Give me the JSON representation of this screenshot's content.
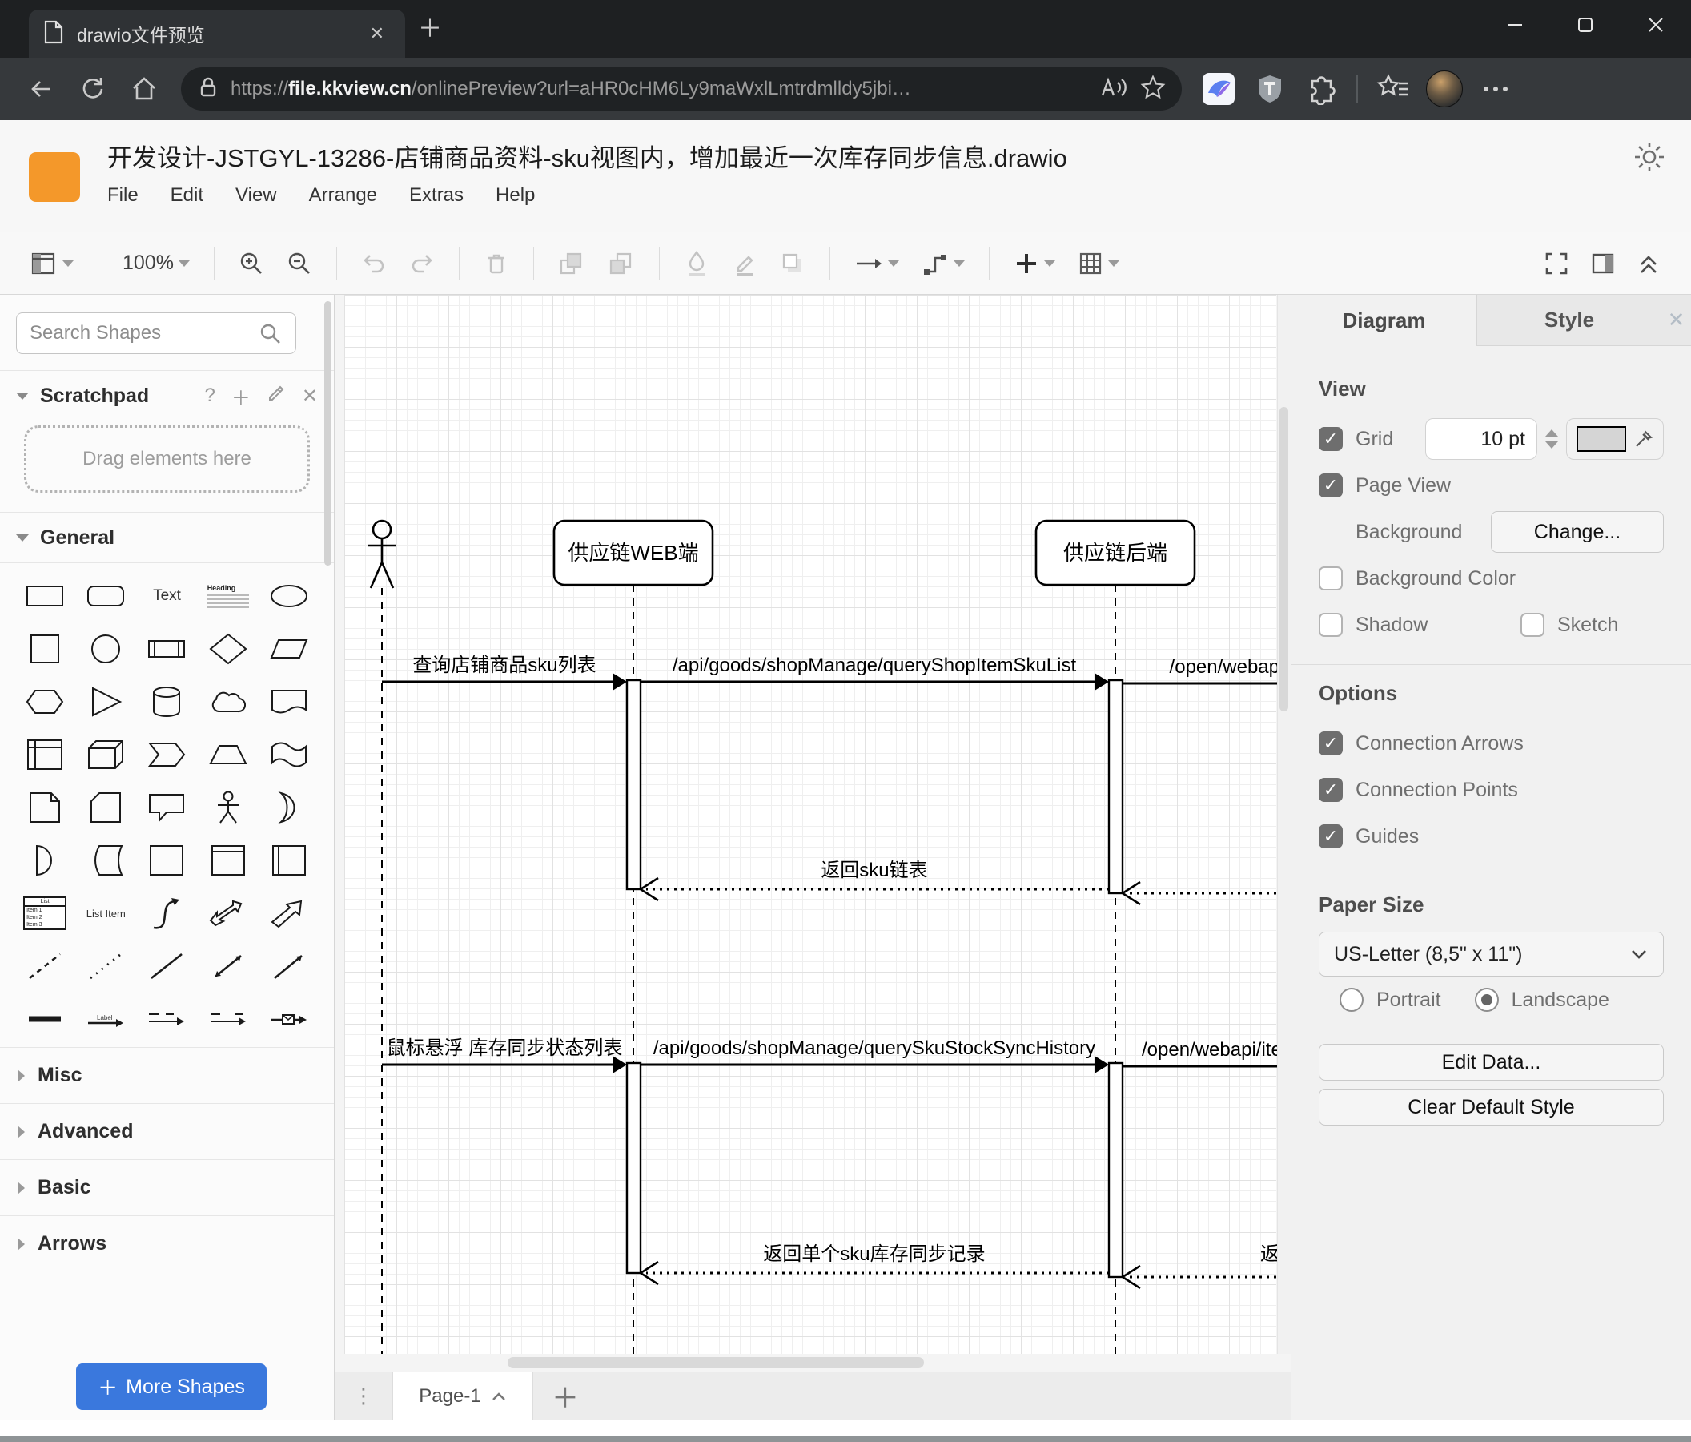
{
  "browser": {
    "tab_title": "drawio文件预览",
    "url": {
      "scheme": "https://",
      "host": "file.kkview.cn",
      "rest": "/onlinePreview?url=aHR0cHM6Ly9maWxlLmtrdmlldy5jbi…"
    }
  },
  "icons": {
    "close": "✕",
    "add": "＋",
    "question": "?",
    "dots_vertical": "⋮"
  },
  "app": {
    "title": "开发设计-JSTGYL-13286-店铺商品资料-sku视图内，增加最近一次库存同步信息.drawio",
    "menu": [
      "File",
      "Edit",
      "View",
      "Arrange",
      "Extras",
      "Help"
    ],
    "zoom": "100%"
  },
  "sidebar": {
    "search_placeholder": "Search Shapes",
    "scratchpad_title": "Scratchpad",
    "scratchpad_hint": "Drag elements here",
    "sections": {
      "general": "General",
      "misc": "Misc",
      "advanced": "Advanced",
      "basic": "Basic",
      "arrows": "Arrows"
    },
    "shapes": {
      "text": "Text",
      "heading": "Heading",
      "list": "List",
      "item1": "Item 1",
      "item2": "Item 2",
      "item3": "Item 3",
      "list_item": "List Item",
      "label": "Label"
    },
    "more_shapes": "More Shapes"
  },
  "diagram": {
    "lifelines": {
      "web": "供应链WEB端",
      "backend": "供应链后端"
    },
    "messages": {
      "m1": "查询店铺商品sku列表",
      "m2": "/api/goods/shopManage/queryShopItemSkuList",
      "m3": "/open/webapi/",
      "r1": "返回sku链表",
      "m4": "鼠标悬浮 库存同步状态列表",
      "m5": "/api/goods/shopManage/querySkuStockSyncHistory",
      "m6": "/open/webapi/iten",
      "r2": "返回单个sku库存同步记录",
      "r3": "返回"
    }
  },
  "panel": {
    "tabs": {
      "diagram": "Diagram",
      "style": "Style"
    },
    "view": {
      "heading": "View",
      "grid": "Grid",
      "grid_checked": true,
      "grid_size": "10 pt",
      "page_view": "Page View",
      "page_view_checked": true,
      "background": "Background",
      "change": "Change...",
      "background_color": "Background Color",
      "background_color_checked": false,
      "shadow": "Shadow",
      "shadow_checked": false,
      "sketch": "Sketch",
      "sketch_checked": false
    },
    "options": {
      "heading": "Options",
      "connection_arrows": "Connection Arrows",
      "connection_arrows_checked": true,
      "connection_points": "Connection Points",
      "connection_points_checked": true,
      "guides": "Guides",
      "guides_checked": true
    },
    "paper": {
      "heading": "Paper Size",
      "size": "US-Letter (8,5\" x 11\")",
      "portrait": "Portrait",
      "portrait_selected": false,
      "landscape": "Landscape",
      "landscape_selected": true
    },
    "buttons": {
      "edit_data": "Edit Data...",
      "clear_default_style": "Clear Default Style"
    }
  },
  "footer": {
    "page_tab": "Page-1"
  }
}
